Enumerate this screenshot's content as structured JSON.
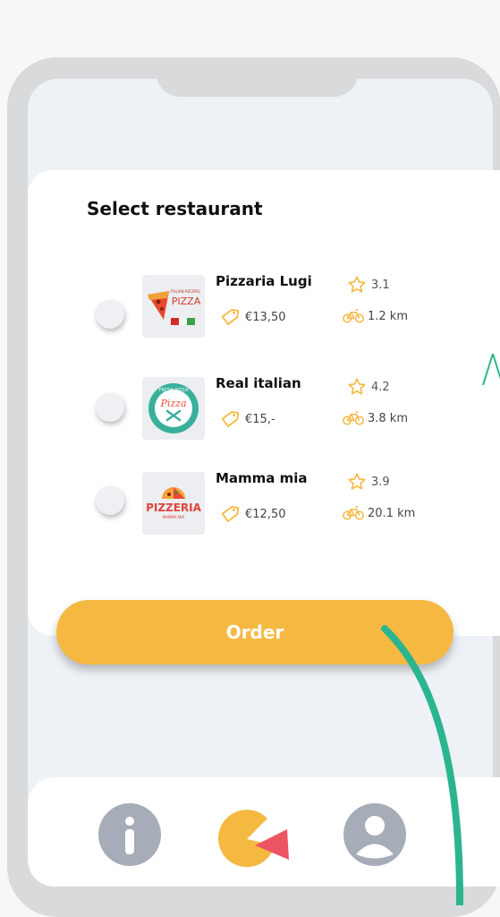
{
  "screen": {
    "title": "Select restaurant"
  },
  "restaurants": [
    {
      "name": "Pizzaria Lugi",
      "rating": "3.1",
      "price": "€13,50",
      "distance": "1.2 km",
      "logo_text": "PIZZA",
      "logo_subtext": "ITALIAN RECIPES"
    },
    {
      "name": "Real italian",
      "rating": "4.2",
      "price": "€15,-",
      "distance": "3.8 km",
      "logo_text": "Pizza",
      "logo_subtext": "FRESH PIZZA"
    },
    {
      "name": "Mamma mia",
      "rating": "3.9",
      "price": "€12,50",
      "distance": "20.1 km",
      "logo_text": "PIZZERIA",
      "logo_subtext": "MAMMA MIA"
    }
  ],
  "actions": {
    "order_label": "Order"
  },
  "nav": {
    "items": [
      {
        "icon": "info-icon",
        "active": false
      },
      {
        "icon": "pie-chart-icon",
        "active": true
      },
      {
        "icon": "user-icon",
        "active": false
      }
    ]
  },
  "colors": {
    "accent": "#f5b942",
    "nav_inactive": "#a6acb8",
    "pie_slice": "#ee5563",
    "annotation_arrow": "#2bb58f"
  }
}
